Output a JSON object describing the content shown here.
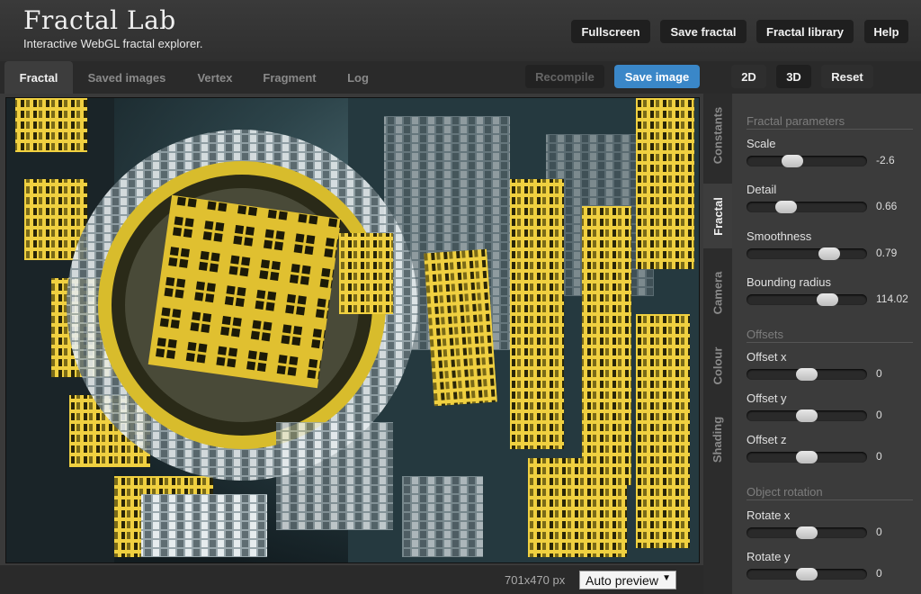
{
  "app": {
    "title": "Fractal Lab",
    "subtitle": "Interactive WebGL fractal explorer."
  },
  "top_buttons": [
    "Fullscreen",
    "Save fractal",
    "Fractal library",
    "Help"
  ],
  "tabs": [
    "Fractal",
    "Saved images",
    "Vertex",
    "Fragment",
    "Log"
  ],
  "actions": {
    "recompile": "Recompile",
    "save_image": "Save image"
  },
  "mode_buttons": [
    "2D",
    "3D",
    "Reset"
  ],
  "side_tabs": [
    "Constants",
    "Fractal",
    "Camera",
    "Colour",
    "Shading"
  ],
  "status": {
    "size": "701x470 px",
    "preview": "Auto preview"
  },
  "sections": {
    "fractal_params": {
      "title": "Fractal parameters",
      "params": [
        {
          "label": "Scale",
          "value": "-2.6",
          "fraction": 0.35
        },
        {
          "label": "Detail",
          "value": "0.66",
          "fraction": 0.29
        },
        {
          "label": "Smoothness",
          "value": "0.79",
          "fraction": 0.73
        },
        {
          "label": "Bounding radius",
          "value": "114.02",
          "fraction": 0.71
        }
      ]
    },
    "offsets": {
      "title": "Offsets",
      "params": [
        {
          "label": "Offset x",
          "value": "0",
          "fraction": 0.5
        },
        {
          "label": "Offset y",
          "value": "0",
          "fraction": 0.5
        },
        {
          "label": "Offset z",
          "value": "0",
          "fraction": 0.5
        }
      ]
    },
    "rotation": {
      "title": "Object rotation",
      "params": [
        {
          "label": "Rotate x",
          "value": "0",
          "fraction": 0.5
        },
        {
          "label": "Rotate y",
          "value": "0",
          "fraction": 0.5
        }
      ]
    }
  },
  "colors": {
    "accent": "#3a87c8",
    "fractal_gold": "#e8c83a",
    "background": "#2e2e2e"
  }
}
